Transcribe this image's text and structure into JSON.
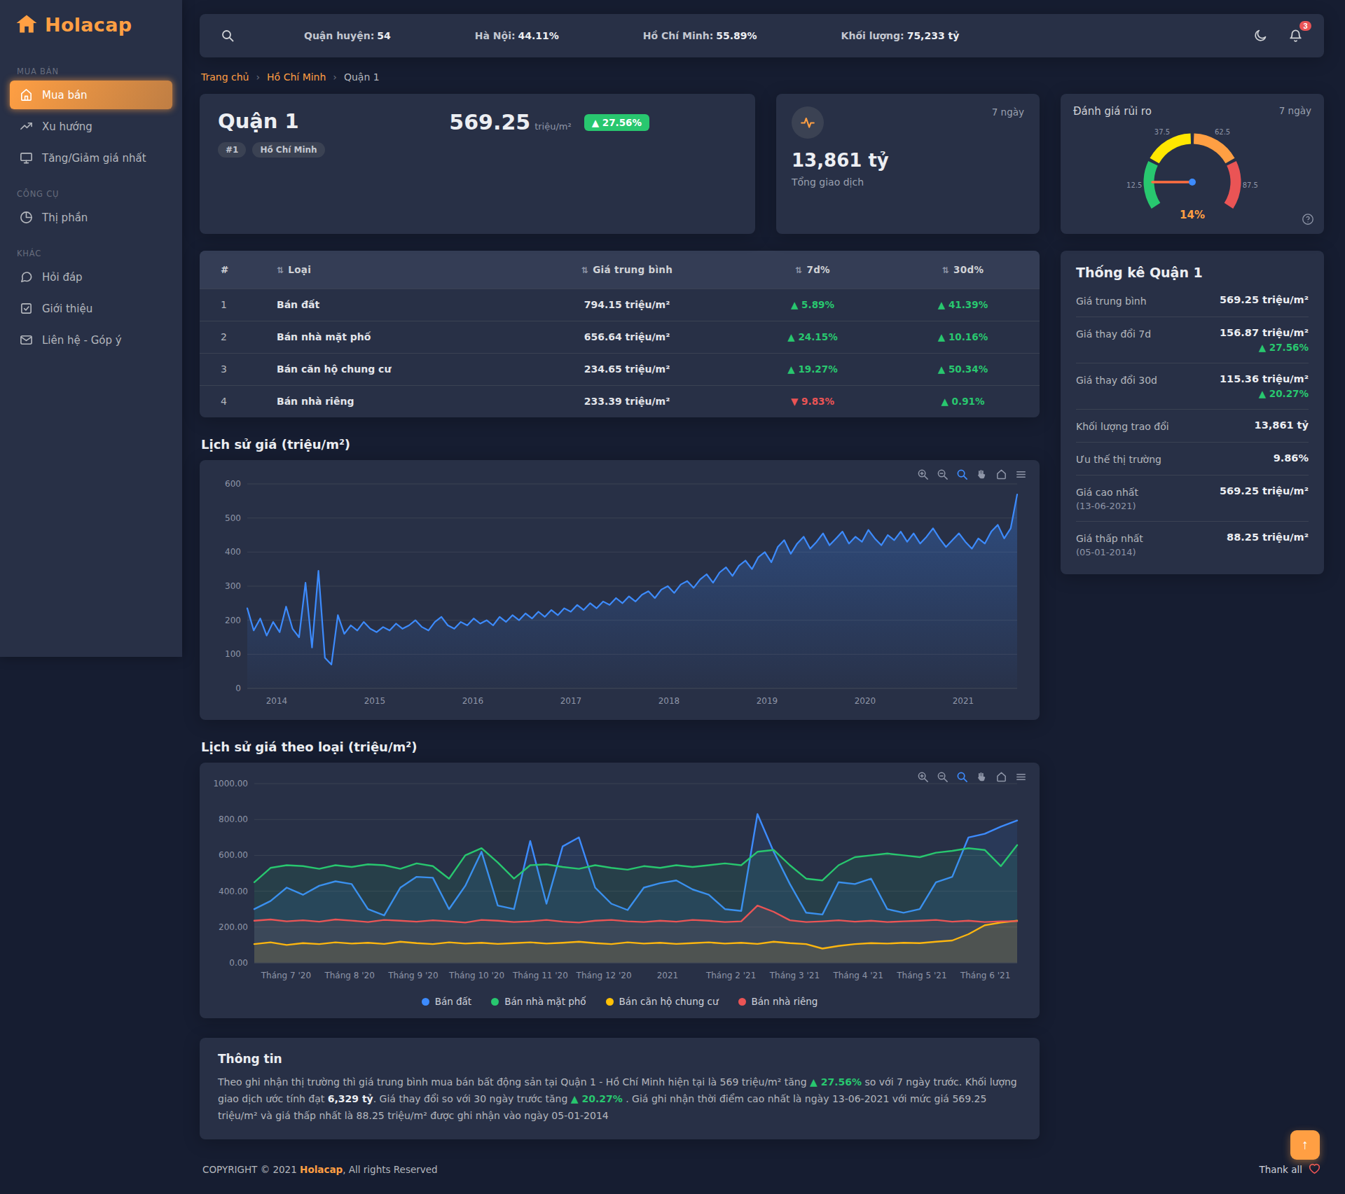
{
  "brand": {
    "name": "Holacap"
  },
  "colors": {
    "primary": "#ff9f43",
    "green": "#28c76f",
    "red": "#ea5455",
    "blue": "#3d8bfd",
    "yellow": "#ffc107"
  },
  "sidebar": {
    "sections": [
      {
        "title": "MUA BÁN",
        "items": [
          {
            "label": "Mua bán",
            "icon": "home-icon",
            "active": true
          },
          {
            "label": "Xu hướng",
            "icon": "trending-up-icon",
            "active": false
          },
          {
            "label": "Tăng/Giảm giá nhất",
            "icon": "monitor-icon",
            "active": false
          }
        ]
      },
      {
        "title": "CÔNG CỤ",
        "items": [
          {
            "label": "Thị phần",
            "icon": "pie-chart-icon",
            "active": false
          }
        ]
      },
      {
        "title": "KHÁC",
        "items": [
          {
            "label": "Hỏi đáp",
            "icon": "message-circle-icon",
            "active": false
          },
          {
            "label": "Giới thiệu",
            "icon": "check-square-icon",
            "active": false
          },
          {
            "label": "Liên hệ - Góp ý",
            "icon": "mail-icon",
            "active": false
          }
        ]
      }
    ]
  },
  "topbar": {
    "search_icon": "search-icon",
    "theme_icon": "moon-icon",
    "bell_icon": "bell-icon",
    "notification_count": "3",
    "stats": [
      {
        "label": "Quận huyện:",
        "value": "54"
      },
      {
        "label": "Hà Nội:",
        "value": "44.11%"
      },
      {
        "label": "Hồ Chí Minh:",
        "value": "55.89%"
      },
      {
        "label": "Khối lượng:",
        "value": "75,233 tỷ"
      }
    ]
  },
  "breadcrumb": {
    "items": [
      "Trang chủ",
      "Hồ Chí Minh",
      "Quận 1"
    ]
  },
  "overview": {
    "title": "Quận 1",
    "rank_badge": "#1",
    "city_badge": "Hồ Chí Minh",
    "price": "569.25",
    "price_unit": "triệu/m²",
    "change": "27.56%",
    "change_dir": "up"
  },
  "transactions": {
    "icon": "activity-icon",
    "period": "7 ngày",
    "value": "13,861 tỷ",
    "label": "Tổng giao dịch"
  },
  "risk": {
    "title": "Đánh giá rủi ro",
    "period": "7 ngày",
    "value_pct": 14,
    "value_label": "14%",
    "help_icon": "help-circle-icon",
    "tick_labels": [
      "12.5",
      "37.5",
      "62.5",
      "87.5"
    ],
    "needle_color": "#ff6e40",
    "segments": [
      {
        "from": 0,
        "to": 25,
        "color": "#28c76f"
      },
      {
        "from": 25,
        "to": 50,
        "color": "#ffe700"
      },
      {
        "from": 50,
        "to": 75,
        "color": "#ff9f43"
      },
      {
        "from": 75,
        "to": 100,
        "color": "#ea5455"
      }
    ]
  },
  "table": {
    "headers": [
      "#",
      "Loại",
      "Giá trung bình",
      "7d%",
      "30d%"
    ],
    "rows": [
      {
        "rank": "1",
        "type": "Bán đất",
        "price": "794.15",
        "unit": "triệu/m²",
        "d7": "5.89%",
        "d7_dir": "up",
        "d30": "41.39%",
        "d30_dir": "up"
      },
      {
        "rank": "2",
        "type": "Bán nhà mặt phố",
        "price": "656.64",
        "unit": "triệu/m²",
        "d7": "24.15%",
        "d7_dir": "up",
        "d30": "10.16%",
        "d30_dir": "up"
      },
      {
        "rank": "3",
        "type": "Bán căn hộ chung cư",
        "price": "234.65",
        "unit": "triệu/m²",
        "d7": "19.27%",
        "d7_dir": "up",
        "d30": "50.34%",
        "d30_dir": "up"
      },
      {
        "rank": "4",
        "type": "Bán nhà riêng",
        "price": "233.39",
        "unit": "triệu/m²",
        "d7": "9.83%",
        "d7_dir": "down",
        "d30": "0.91%",
        "d30_dir": "up"
      }
    ]
  },
  "stats_panel": {
    "title": "Thống kê Quận 1",
    "rows": [
      {
        "label": "Giá trung bình",
        "value": "569.25 triệu/m²"
      },
      {
        "label": "Giá thay đổi 7d",
        "value": "156.87 triệu/m²",
        "change": "27.56%",
        "change_dir": "up"
      },
      {
        "label": "Giá thay đổi 30d",
        "value": "115.36 triệu/m²",
        "change": "20.27%",
        "change_dir": "up"
      },
      {
        "label": "Khối lượng trao đổi",
        "value": "13,861 tỷ"
      },
      {
        "label": "Ưu thế thị trường",
        "value": "9.86%"
      },
      {
        "label": "Giá cao nhất",
        "sublabel": "(13-06-2021)",
        "value": "569.25 triệu/m²"
      },
      {
        "label": "Giá thấp nhất",
        "sublabel": "(05-01-2014)",
        "value": "88.25 triệu/m²"
      }
    ]
  },
  "chart_toolbar": [
    "zoom-in-icon",
    "zoom-out-icon",
    "selection-zoom-icon",
    "pan-icon",
    "home-icon",
    "menu-icon"
  ],
  "chart_data": [
    {
      "type": "line",
      "title": "Lịch sử giá (triệu/m²)",
      "xlabel": "",
      "ylabel": "triệu/m²",
      "grid": true,
      "legend_position": "none",
      "x_domain": [
        2013.7,
        2021.55
      ],
      "x_ticks": [
        2014,
        2015,
        2016,
        2017,
        2018,
        2019,
        2020,
        2021
      ],
      "ylim": [
        0,
        600
      ],
      "y_ticks": [
        0,
        100,
        200,
        300,
        400,
        500,
        600
      ],
      "series": [
        {
          "name": "Giá trung bình",
          "color": "#3d8bfd",
          "values": [
            235,
            170,
            205,
            155,
            195,
            165,
            240,
            175,
            150,
            310,
            120,
            345,
            90,
            70,
            215,
            160,
            185,
            170,
            195,
            175,
            165,
            180,
            170,
            190,
            175,
            185,
            200,
            180,
            170,
            195,
            210,
            185,
            175,
            195,
            185,
            205,
            190,
            200,
            185,
            210,
            195,
            215,
            200,
            220,
            205,
            225,
            210,
            230,
            215,
            235,
            225,
            245,
            230,
            250,
            235,
            255,
            245,
            265,
            250,
            270,
            255,
            275,
            285,
            265,
            290,
            300,
            280,
            305,
            315,
            295,
            320,
            335,
            310,
            340,
            355,
            330,
            360,
            375,
            350,
            385,
            400,
            370,
            415,
            435,
            395,
            425,
            445,
            410,
            430,
            455,
            420,
            440,
            460,
            425,
            445,
            430,
            465,
            440,
            420,
            450,
            435,
            460,
            430,
            455,
            425,
            445,
            470,
            440,
            415,
            435,
            455,
            430,
            410,
            440,
            425,
            460,
            480,
            440,
            470,
            569
          ]
        }
      ]
    },
    {
      "type": "line",
      "title": "Lịch sử giá theo loại (triệu/m²)",
      "xlabel": "",
      "ylabel": "triệu/m²",
      "grid": true,
      "legend_position": "bottom",
      "x_labels": [
        "Tháng 7 '20",
        "Tháng 8 '20",
        "Tháng 9 '20",
        "Tháng 10 '20",
        "Tháng 11 '20",
        "Tháng 12 '20",
        "2021",
        "Tháng 2 '21",
        "Tháng 3 '21",
        "Tháng 4 '21",
        "Tháng 5 '21",
        "Tháng 6 '21"
      ],
      "ylim": [
        0,
        1000
      ],
      "y_ticks": [
        0,
        200,
        400,
        600,
        800,
        1000
      ],
      "y_tick_labels": [
        "0.00",
        "200.00",
        "400.00",
        "600.00",
        "800.00",
        "1000.00"
      ],
      "series": [
        {
          "name": "Bán đất",
          "color": "#3d8bfd",
          "values": [
            300,
            345,
            420,
            380,
            430,
            455,
            440,
            300,
            265,
            420,
            480,
            475,
            300,
            430,
            620,
            320,
            300,
            680,
            330,
            650,
            700,
            420,
            330,
            295,
            420,
            445,
            460,
            410,
            380,
            300,
            290,
            830,
            620,
            440,
            280,
            270,
            450,
            440,
            470,
            300,
            280,
            300,
            450,
            480,
            700,
            720,
            760,
            794
          ]
        },
        {
          "name": "Bán nhà mặt phố",
          "color": "#28c76f",
          "values": [
            450,
            530,
            545,
            540,
            525,
            545,
            535,
            550,
            545,
            525,
            555,
            540,
            470,
            600,
            640,
            560,
            470,
            545,
            550,
            535,
            525,
            545,
            530,
            520,
            540,
            530,
            545,
            535,
            545,
            555,
            545,
            620,
            630,
            545,
            470,
            460,
            545,
            590,
            600,
            610,
            600,
            590,
            615,
            625,
            640,
            630,
            540,
            657
          ]
        },
        {
          "name": "Bán căn hộ chung cư",
          "color": "#ffc107",
          "values": [
            105,
            115,
            100,
            110,
            105,
            115,
            108,
            112,
            106,
            118,
            110,
            105,
            115,
            108,
            112,
            106,
            110,
            115,
            108,
            112,
            118,
            110,
            105,
            115,
            108,
            112,
            106,
            110,
            115,
            108,
            112,
            106,
            118,
            110,
            105,
            80,
            95,
            105,
            110,
            108,
            112,
            110,
            118,
            125,
            160,
            210,
            225,
            235
          ]
        },
        {
          "name": "Bán nhà riêng",
          "color": "#ea5455",
          "values": [
            235,
            242,
            232,
            238,
            230,
            242,
            236,
            228,
            240,
            235,
            230,
            238,
            232,
            225,
            240,
            235,
            228,
            232,
            240,
            230,
            225,
            235,
            240,
            232,
            228,
            235,
            230,
            240,
            235,
            228,
            232,
            320,
            285,
            238,
            228,
            232,
            238,
            230,
            235,
            228,
            232,
            235,
            240,
            230,
            235,
            228,
            232,
            233
          ]
        }
      ]
    }
  ],
  "info": {
    "title": "Thông tin",
    "segments": [
      {
        "text": "Theo ghi nhận thị trường thì giá trung bình mua bán bất động sản tại Quận 1 - Hồ Chí Minh hiện tại là 569 triệu/m² tăng ",
        "style": "normal"
      },
      {
        "text": "▲ 27.56%",
        "style": "up"
      },
      {
        "text": " so với 7 ngày trước. Khối lượng giao dịch ước tính đạt ",
        "style": "normal"
      },
      {
        "text": "6,329 tỷ",
        "style": "bold"
      },
      {
        "text": ". Giá thay đổi so với 30 ngày trước tăng ",
        "style": "normal"
      },
      {
        "text": "▲ 20.27%",
        "style": "up"
      },
      {
        "text": " . Giá ghi nhận thời điểm cao nhất là ngày 13-06-2021 với mức giá 569.25 triệu/m² và giá thấp nhất là 88.25 triệu/m² được ghi nhận vào ngày 05-01-2014",
        "style": "normal"
      }
    ]
  },
  "footer": {
    "copyright_prefix": "COPYRIGHT © 2021 ",
    "brand": "Holacap",
    "copyright_suffix": ", All rights Reserved",
    "thanks": "Thank all",
    "heart_icon": "heart-icon"
  },
  "misc": {
    "scroll_top_icon": "arrow-up-icon"
  }
}
